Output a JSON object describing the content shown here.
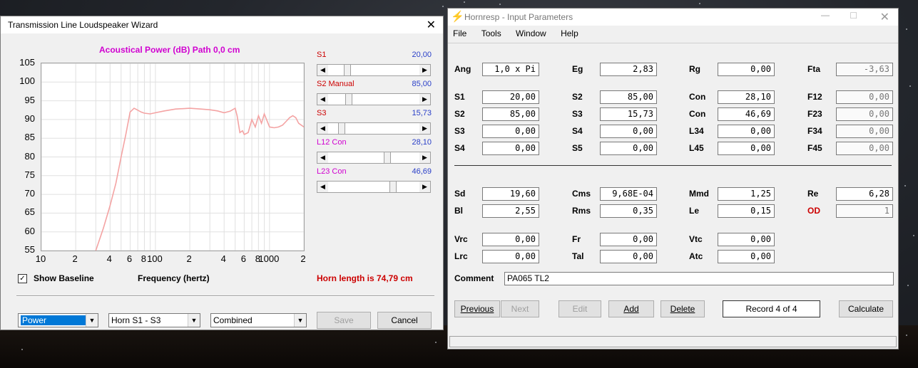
{
  "wizard": {
    "title": "Transmission Line Loudspeaker Wizard",
    "chart_title": "Acoustical Power (dB)   Path 0,0 cm",
    "sliders": [
      {
        "label": "S1",
        "value": "20,00",
        "color": "#cc0000"
      },
      {
        "label": "S2  Manual",
        "value": "85,00",
        "color": "#cc0000"
      },
      {
        "label": "S3",
        "value": "15,73",
        "color": "#cc0000"
      },
      {
        "label": "L12  Con",
        "value": "28,10",
        "color": "#d000d0"
      },
      {
        "label": "L23  Con",
        "value": "46,69",
        "color": "#d000d0"
      }
    ],
    "show_baseline": "Show Baseline",
    "frequency_label": "Frequency (hertz)",
    "horn_length": "Horn length is 74,79 cm",
    "combo_power": "Power",
    "combo_horn": "Horn S1 - S3",
    "combo_combined": "Combined",
    "save_label": "Save",
    "cancel_label": "Cancel"
  },
  "chart_data": {
    "type": "line",
    "title": "Acoustical Power (dB)   Path 0,0 cm",
    "xlabel": "Frequency (hertz)",
    "x_scale": "log",
    "xlim": [
      10,
      2000
    ],
    "ylim": [
      55,
      105
    ],
    "yticks": [
      "105",
      "100",
      "95",
      "90",
      "85",
      "80",
      "75",
      "70",
      "65",
      "60",
      "55"
    ],
    "xticks": [
      {
        "label": "10",
        "v": 10
      },
      {
        "label": "2",
        "v": 20
      },
      {
        "label": "4",
        "v": 40
      },
      {
        "label": "6",
        "v": 60
      },
      {
        "label": "8",
        "v": 80
      },
      {
        "label": "100",
        "v": 100
      },
      {
        "label": "2",
        "v": 200
      },
      {
        "label": "4",
        "v": 400
      },
      {
        "label": "6",
        "v": 600
      },
      {
        "label": "8",
        "v": 800
      },
      {
        "label": "1000",
        "v": 1000
      },
      {
        "label": "2",
        "v": 2000
      }
    ],
    "series": [
      {
        "color": "#f4a3a3",
        "x": [
          30,
          35,
          40,
          45,
          50,
          55,
          60,
          65,
          70,
          75,
          80,
          90,
          100,
          120,
          150,
          200,
          250,
          300,
          350,
          400,
          450,
          500,
          520,
          550,
          580,
          600,
          650,
          700,
          750,
          800,
          850,
          900,
          1000,
          1100,
          1200,
          1300,
          1400,
          1500,
          1600,
          1700,
          1800,
          1900,
          2000
        ],
        "y": [
          55,
          61,
          67,
          73,
          80,
          86,
          92,
          93,
          92.5,
          92,
          91.7,
          91.5,
          91.8,
          92.3,
          92.8,
          93,
          92.8,
          92.6,
          92.3,
          91.8,
          92.2,
          93,
          91,
          86.5,
          87,
          86,
          86.5,
          90,
          88,
          91,
          89,
          91.5,
          88,
          87.8,
          88,
          88.5,
          89.5,
          90.5,
          91,
          90.5,
          89,
          88.5,
          88
        ]
      }
    ]
  },
  "hornresp": {
    "title": "Hornresp - Input Parameters",
    "menu": [
      "File",
      "Tools",
      "Window",
      "Help"
    ],
    "params": [
      {
        "label": "Ang",
        "value": "1,0 x Pi",
        "col": 0,
        "row": 0
      },
      {
        "label": "Eg",
        "value": "2,83",
        "col": 1,
        "row": 0
      },
      {
        "label": "Rg",
        "value": "0,00",
        "col": 2,
        "row": 0
      },
      {
        "label": "Fta",
        "value": "-3,63",
        "col": 3,
        "row": 0,
        "ro": true
      },
      {
        "label": "S1",
        "value": "20,00",
        "col": 0,
        "row": 1
      },
      {
        "label": "S2",
        "value": "85,00",
        "col": 1,
        "row": 1
      },
      {
        "label": "Con",
        "value": "28,10",
        "col": 2,
        "row": 1
      },
      {
        "label": "F12",
        "value": "0,00",
        "col": 3,
        "row": 1,
        "ro": true
      },
      {
        "label": "S2",
        "value": "85,00",
        "col": 0,
        "row": 2
      },
      {
        "label": "S3",
        "value": "15,73",
        "col": 1,
        "row": 2
      },
      {
        "label": "Con",
        "value": "46,69",
        "col": 2,
        "row": 2
      },
      {
        "label": "F23",
        "value": "0,00",
        "col": 3,
        "row": 2,
        "ro": true
      },
      {
        "label": "S3",
        "value": "0,00",
        "col": 0,
        "row": 3
      },
      {
        "label": "S4",
        "value": "0,00",
        "col": 1,
        "row": 3
      },
      {
        "label": "L34",
        "value": "0,00",
        "col": 2,
        "row": 3
      },
      {
        "label": "F34",
        "value": "0,00",
        "col": 3,
        "row": 3,
        "ro": true
      },
      {
        "label": "S4",
        "value": "0,00",
        "col": 0,
        "row": 4
      },
      {
        "label": "S5",
        "value": "0,00",
        "col": 1,
        "row": 4
      },
      {
        "label": "L45",
        "value": "0,00",
        "col": 2,
        "row": 4
      },
      {
        "label": "F45",
        "value": "0,00",
        "col": 3,
        "row": 4,
        "ro": true
      },
      {
        "label": "Sd",
        "value": "19,60",
        "col": 0,
        "row": 5
      },
      {
        "label": "Cms",
        "value": "9,68E-04",
        "col": 1,
        "row": 5
      },
      {
        "label": "Mmd",
        "value": "1,25",
        "col": 2,
        "row": 5
      },
      {
        "label": "Re",
        "value": "6,28",
        "col": 3,
        "row": 5
      },
      {
        "label": "Bl",
        "value": "2,55",
        "col": 0,
        "row": 6
      },
      {
        "label": "Rms",
        "value": "0,35",
        "col": 1,
        "row": 6
      },
      {
        "label": "Le",
        "value": "0,15",
        "col": 2,
        "row": 6
      },
      {
        "label": "OD",
        "value": "1",
        "col": 3,
        "row": 6,
        "ro": true,
        "red": true
      },
      {
        "label": "Vrc",
        "value": "0,00",
        "col": 0,
        "row": 7
      },
      {
        "label": "Fr",
        "value": "0,00",
        "col": 1,
        "row": 7
      },
      {
        "label": "Vtc",
        "value": "0,00",
        "col": 2,
        "row": 7
      },
      {
        "label": "Lrc",
        "value": "0,00",
        "col": 0,
        "row": 8
      },
      {
        "label": "Tal",
        "value": "0,00",
        "col": 1,
        "row": 8
      },
      {
        "label": "Atc",
        "value": "0,00",
        "col": 2,
        "row": 8
      }
    ],
    "comment_label": "Comment",
    "comment_value": "PA065 TL2",
    "buttons": {
      "previous": "Previous",
      "next": "Next",
      "edit": "Edit",
      "add": "Add",
      "delete": "Delete",
      "record": "Record 4 of 4",
      "calculate": "Calculate"
    }
  }
}
